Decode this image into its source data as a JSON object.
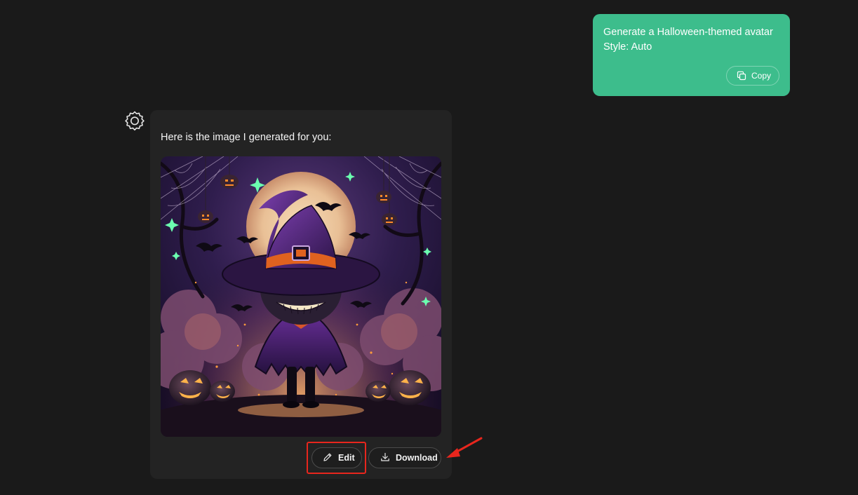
{
  "user_message": {
    "line1": "Generate a Halloween-themed avatar",
    "line2": "Style: Auto",
    "copy_label": "Copy",
    "bubble_color": "#3dbd8c"
  },
  "assistant": {
    "avatar_icon": "gear-icon",
    "intro_text": "Here is the image I generated for you:",
    "image_alt": "Halloween-themed avatar",
    "edit_label": "Edit",
    "download_label": "Download"
  },
  "annotation": {
    "highlight_color": "#e8261d"
  }
}
